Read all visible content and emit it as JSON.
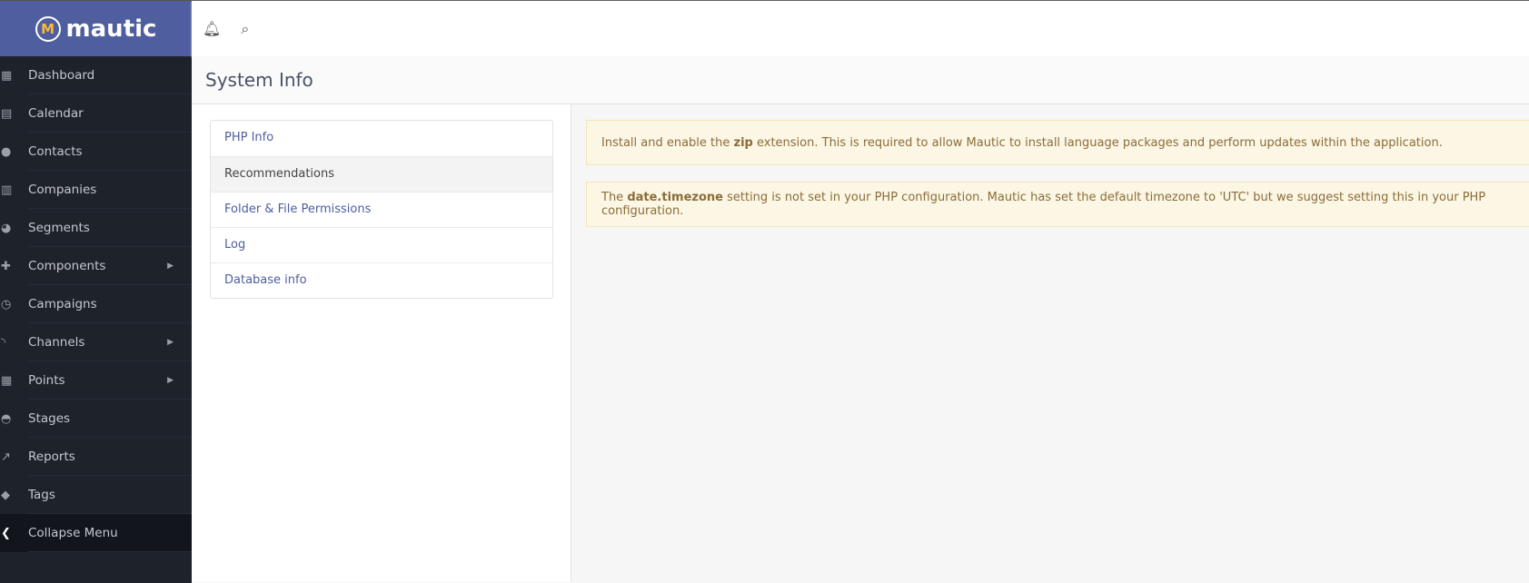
{
  "brand": {
    "name": "mautic"
  },
  "sidebar": {
    "items": [
      {
        "label": "Dashboard",
        "icon": "grid-icon",
        "glyph": "▦"
      },
      {
        "label": "Calendar",
        "icon": "calendar-icon",
        "glyph": "▤"
      },
      {
        "label": "Contacts",
        "icon": "user-icon",
        "glyph": "●"
      },
      {
        "label": "Companies",
        "icon": "building-icon",
        "glyph": "▥"
      },
      {
        "label": "Segments",
        "icon": "pie-chart-icon",
        "glyph": "◕"
      },
      {
        "label": "Components",
        "icon": "puzzle-icon",
        "glyph": "✚",
        "submenu": true
      },
      {
        "label": "Campaigns",
        "icon": "clock-icon",
        "glyph": "◷"
      },
      {
        "label": "Channels",
        "icon": "rss-icon",
        "glyph": "◝",
        "submenu": true
      },
      {
        "label": "Points",
        "icon": "calculator-icon",
        "glyph": "▦",
        "submenu": true
      },
      {
        "label": "Stages",
        "icon": "tachometer-icon",
        "glyph": "◓"
      },
      {
        "label": "Reports",
        "icon": "line-chart-icon",
        "glyph": "↗"
      },
      {
        "label": "Tags",
        "icon": "tag-icon",
        "glyph": "◆"
      }
    ],
    "collapse": "Collapse Menu"
  },
  "page": {
    "title": "System Info"
  },
  "menu": [
    "PHP Info",
    "Recommendations",
    "Folder & File Permissions",
    "Log",
    "Database info"
  ],
  "alerts": [
    {
      "pre": "Install and enable the ",
      "bold": "zip",
      "post": " extension. This is required to allow Mautic to install language packages and perform updates within the application."
    },
    {
      "pre": "The ",
      "bold": "date.timezone",
      "post": " setting is not set in your PHP configuration. Mautic has set the default timezone to 'UTC' but we suggest setting this in your PHP configuration."
    }
  ]
}
